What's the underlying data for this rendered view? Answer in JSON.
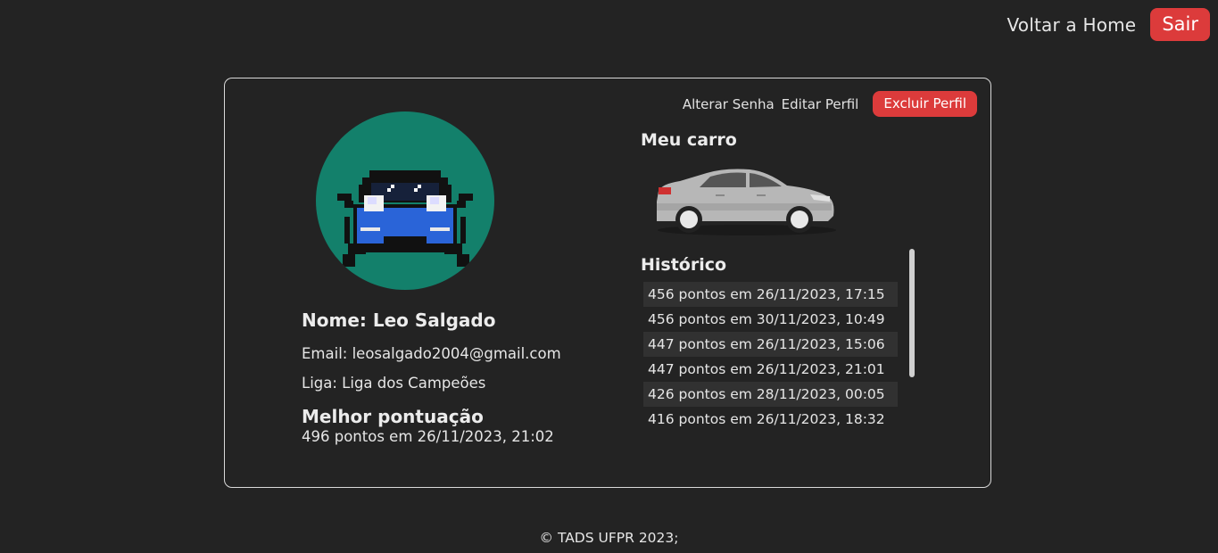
{
  "nav": {
    "home_label": "Voltar a Home",
    "logout_label": "Sair"
  },
  "profile_actions": {
    "change_password": "Alterar Senha",
    "edit_profile": "Editar Perfil",
    "delete_profile": "Excluir Perfil"
  },
  "user": {
    "name": "Nome: Leo Salgado",
    "email": "Email: leosalgado2004@gmail.com",
    "league": "Liga: Liga dos Campeões",
    "avatar": "pixel-car-avatar-icon"
  },
  "best_score": {
    "title": "Melhor pontuação",
    "value": "496 pontos em 26/11/2023, 21:02"
  },
  "car": {
    "title": "Meu carro",
    "image": "silver-sedan-icon"
  },
  "history": {
    "title": "Histórico",
    "rows": [
      "456 pontos em 26/11/2023, 17:15",
      "456 pontos em 30/11/2023, 10:49",
      "447 pontos em 26/11/2023, 15:06",
      "447 pontos em 26/11/2023, 21:01",
      "426 pontos em 28/11/2023, 00:05",
      "416 pontos em 26/11/2023, 18:32"
    ]
  },
  "footer": {
    "text": "© TADS UFPR 2023;"
  },
  "colors": {
    "background": "#232323",
    "danger": "#dc3b3b",
    "avatar_bg": "#13806b",
    "car_blue": "#2a64d8"
  }
}
